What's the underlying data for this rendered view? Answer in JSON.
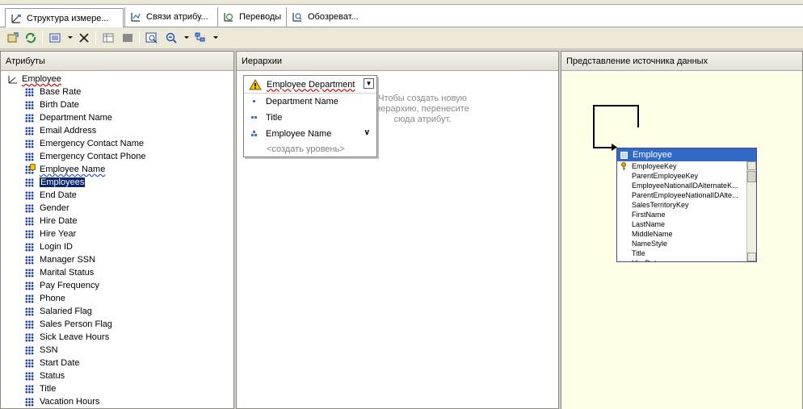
{
  "tabs": [
    {
      "label": "Структура измере...",
      "icon": "dimension-structure-icon",
      "active": true
    },
    {
      "label": "Связи атрибу...",
      "icon": "attribute-relationships-icon",
      "active": false
    },
    {
      "label": "Переводы",
      "icon": "translations-icon",
      "active": false
    },
    {
      "label": "Обозреват...",
      "icon": "browser-icon",
      "active": false
    }
  ],
  "panes": {
    "attributes": {
      "header": "Атрибуты"
    },
    "hierarchies": {
      "header": "Иерархии"
    },
    "dsv": {
      "header": "Представление источника данных"
    }
  },
  "dimension": {
    "name": "Employee",
    "attributes": [
      "Base Rate",
      "Birth Date",
      "Department Name",
      "Email Address",
      "Emergency Contact Name",
      "Emergency Contact Phone",
      "Employee Name",
      "Employees",
      "End Date",
      "Gender",
      "Hire Date",
      "Hire Year",
      "Login ID",
      "Manager SSN",
      "Marital Status",
      "Pay Frequency",
      "Phone",
      "Salaried Flag",
      "Sales Person Flag",
      "Sick Leave Hours",
      "SSN",
      "Start Date",
      "Status",
      "Title",
      "Vacation Hours"
    ],
    "warning_attribute": "Employee Name",
    "selected_attribute": "Employees"
  },
  "hierarchy": {
    "name": "Employee Department",
    "levels": [
      "Department Name",
      "Title",
      "Employee Name"
    ],
    "new_level": "<создать уровень>",
    "hint": "Чтобы создать новую иерархию, перенесите сюда атрибут."
  },
  "dsv_table": {
    "name": "Employee",
    "columns": [
      "EmployeeKey",
      "ParentEmployeeKey",
      "EmployeeNationalIDAlternateK...",
      "ParentEmployeeNationalIDAlte...",
      "SalesTerritoryKey",
      "FirstName",
      "LastName",
      "MiddleName",
      "NameStyle",
      "Title",
      "HireDate"
    ]
  },
  "colors": {
    "selection": "#0a246a",
    "attribute_icon": "#1d3ea8",
    "dsv_background": "#fffee7",
    "dsv_title": "#316ac5"
  }
}
